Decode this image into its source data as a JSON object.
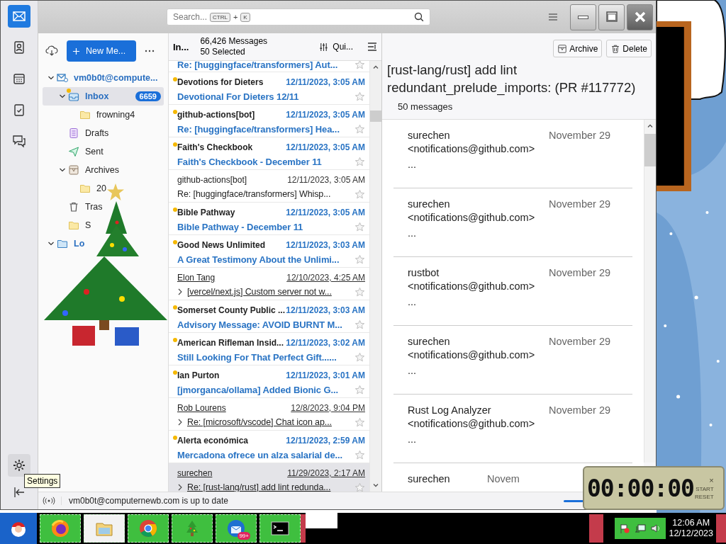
{
  "rail": [
    {
      "kind": "mail",
      "selected": true
    },
    {
      "kind": "contacts",
      "selected": false
    },
    {
      "kind": "calendar",
      "selected": false
    },
    {
      "kind": "tasks",
      "selected": false
    },
    {
      "kind": "chat",
      "selected": false
    }
  ],
  "rail_bottom": {
    "tooltip": "Settings"
  },
  "search": {
    "placeholder": "Search...",
    "keys": [
      "CTRL",
      "+",
      "K"
    ]
  },
  "toolbar": {
    "new_message": "New Me..."
  },
  "folders": [
    {
      "kind": "account",
      "label": "vm0b0t@compute...",
      "expanded": true,
      "selected": false,
      "children": [
        {
          "kind": "inbox",
          "label": "Inbox",
          "badge": "6659",
          "unread": true,
          "expanded": true,
          "selected": true,
          "children": [
            {
              "kind": "folder",
              "label": "frowning4",
              "selected": false
            }
          ]
        },
        {
          "kind": "drafts",
          "label": "Drafts",
          "selected": false
        },
        {
          "kind": "sent",
          "label": "Sent",
          "selected": false
        },
        {
          "kind": "archives",
          "label": "Archives",
          "expanded": true,
          "selected": false,
          "children": [
            {
              "kind": "folder",
              "label": "20",
              "selected": false
            }
          ]
        },
        {
          "kind": "trash",
          "label": "Tras",
          "selected": false
        },
        {
          "kind": "folder",
          "label": "S",
          "selected": false
        }
      ]
    },
    {
      "kind": "local",
      "label": "Lo",
      "expanded": true,
      "selected": false
    }
  ],
  "list_header": {
    "folder": "In...",
    "count": "66,426 Messages",
    "selection": "50 Selected",
    "quick_filter": "Qui..."
  },
  "messages": [
    {
      "subject": "Re: [huggingface/transformers] Aut...",
      "unread": true,
      "selected": false
    },
    {
      "sender": "Devotions for Dieters",
      "date": "12/11/2023, 3:05 AM",
      "subject": "Devotional For Dieters 12/11",
      "unread": true,
      "thread": false,
      "selected": false
    },
    {
      "sender": "github-actions[bot]",
      "date": "12/11/2023, 3:05 AM",
      "subject": "Re: [huggingface/transformers] Hea...",
      "unread": true,
      "thread": false,
      "selected": false
    },
    {
      "sender": "Faith's Checkbook",
      "date": "12/11/2023, 3:05 AM",
      "subject": "Faith's Checkbook - December 11",
      "unread": true,
      "thread": false,
      "selected": false
    },
    {
      "sender": "github-actions[bot]",
      "date": "12/11/2023, 3:05 AM",
      "subject": "Re: [huggingface/transformers] Whisp...",
      "unread": false,
      "thread": false,
      "selected": false
    },
    {
      "sender": "Bible Pathway",
      "date": "12/11/2023, 3:05 AM",
      "subject": "Bible Pathway - December 11",
      "unread": true,
      "thread": false,
      "selected": false
    },
    {
      "sender": "Good News Unlimited",
      "date": "12/11/2023, 3:03 AM",
      "subject": "A Great Testimony About the Unlimi...",
      "unread": true,
      "thread": false,
      "selected": false
    },
    {
      "sender": "Elon Tang",
      "date": "12/10/2023, 4:25 AM",
      "subject": "[vercel/next.js] Custom server not w...",
      "unread": false,
      "thread": true,
      "selected": false
    },
    {
      "sender": "Somerset County Public ...",
      "date": "12/11/2023, 3:03 AM",
      "subject": "Advisory Message: AVOID BURNT M...",
      "unread": true,
      "thread": false,
      "selected": false
    },
    {
      "sender": "American Rifleman Insid...",
      "date": "12/11/2023, 3:02 AM",
      "subject": "Still Looking For That Perfect Gift......",
      "unread": true,
      "thread": false,
      "selected": false
    },
    {
      "sender": "Ian Purton",
      "date": "12/11/2023, 3:01 AM",
      "subject": "[jmorganca/ollama] Added Bionic G...",
      "unread": true,
      "thread": false,
      "selected": false
    },
    {
      "sender": "Rob Lourens",
      "date": "12/8/2023, 9:04 PM",
      "subject": "Re: [microsoft/vscode] Chat icon ap...",
      "unread": false,
      "thread": true,
      "selected": false
    },
    {
      "sender": "Alerta económica",
      "date": "12/11/2023, 2:59 AM",
      "subject": "Mercadona ofrece un alza salarial de...",
      "unread": true,
      "thread": false,
      "selected": false
    },
    {
      "sender": "surechen",
      "date": "11/29/2023, 2:17 AM",
      "subject": "Re: [rust-lang/rust] add lint redunda...",
      "unread": false,
      "thread": true,
      "selected": true
    }
  ],
  "reader": {
    "buttons": [
      {
        "kind": "archive",
        "label": "Archive"
      },
      {
        "kind": "delete",
        "label": "Delete"
      }
    ],
    "title": "[rust-lang/rust] add lint redundant_prelude_imports: (PR #117772)",
    "count": "50 messages",
    "cards": [
      {
        "sender": "surechen",
        "date": "November 29",
        "email": "<notifications@github.com>",
        "snippet": "..."
      },
      {
        "sender": "surechen",
        "date": "November 29",
        "email": "<notifications@github.com>",
        "snippet": "..."
      },
      {
        "sender": "rustbot",
        "date": "November 29",
        "email": "<notifications@github.com>",
        "snippet": "..."
      },
      {
        "sender": "surechen",
        "date": "November 29",
        "email": "<notifications@github.com>",
        "snippet": "..."
      },
      {
        "sender": "Rust Log Analyzer",
        "date": "November 29",
        "email": "<notifications@github.com>",
        "snippet": "..."
      },
      {
        "sender": "surechen",
        "date": "Novem"
      }
    ]
  },
  "status": "vm0b0t@computernewb.com is up to date",
  "stopwatch": {
    "time": "00:00:00",
    "start": "START",
    "reset": "RESET",
    "close": "×"
  },
  "taskbar": {
    "apps": [
      {
        "kind": "browser"
      },
      {
        "kind": "files"
      },
      {
        "kind": "chrome"
      },
      {
        "kind": "tree"
      },
      {
        "kind": "mail",
        "badge": "99+"
      },
      {
        "kind": "terminal"
      }
    ],
    "clock": {
      "time": "12:06 AM",
      "date": "12/12/2023"
    }
  }
}
